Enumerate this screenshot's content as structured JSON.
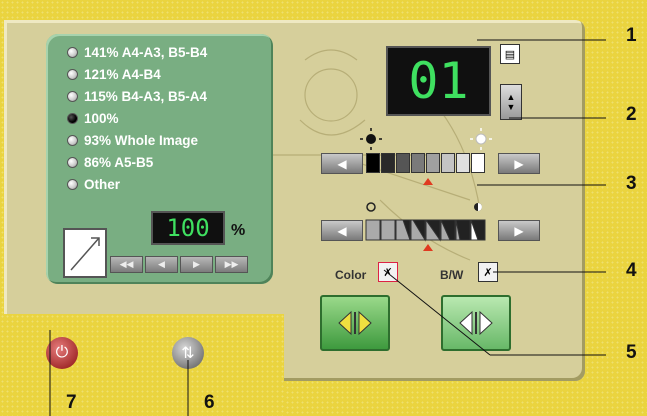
{
  "reduction_options": [
    {
      "label": "141% A4-A3, B5-B4",
      "selected": false
    },
    {
      "label": "121% A4-B4",
      "selected": false
    },
    {
      "label": "115% B4-A3, B5-A4",
      "selected": false
    },
    {
      "label": "100%",
      "selected": true
    },
    {
      "label": "93% Whole Image",
      "selected": false
    },
    {
      "label": "86% A5-B5",
      "selected": false
    },
    {
      "label": "Other",
      "selected": false
    }
  ],
  "zoom_display": "100",
  "percent_sign": "%",
  "copies_display": "01",
  "density": {
    "selected_index": 4
  },
  "contrast": {
    "selected_index": 4
  },
  "buttons": {
    "color_label": "Color",
    "bw_label": "B/W"
  },
  "callouts": [
    "1",
    "2",
    "3",
    "4",
    "5",
    "6",
    "7"
  ],
  "colors": {
    "background": "#ead43f",
    "panel": "#d6cf9b",
    "green_panel": "#79ae82",
    "lcd_text": "#3fe060",
    "accent": "#e03a20"
  },
  "icons": {
    "power": "power-icon",
    "start": "copy-start-icon",
    "copies": "document-icon",
    "arrows": "arrow-left-right-icon"
  }
}
